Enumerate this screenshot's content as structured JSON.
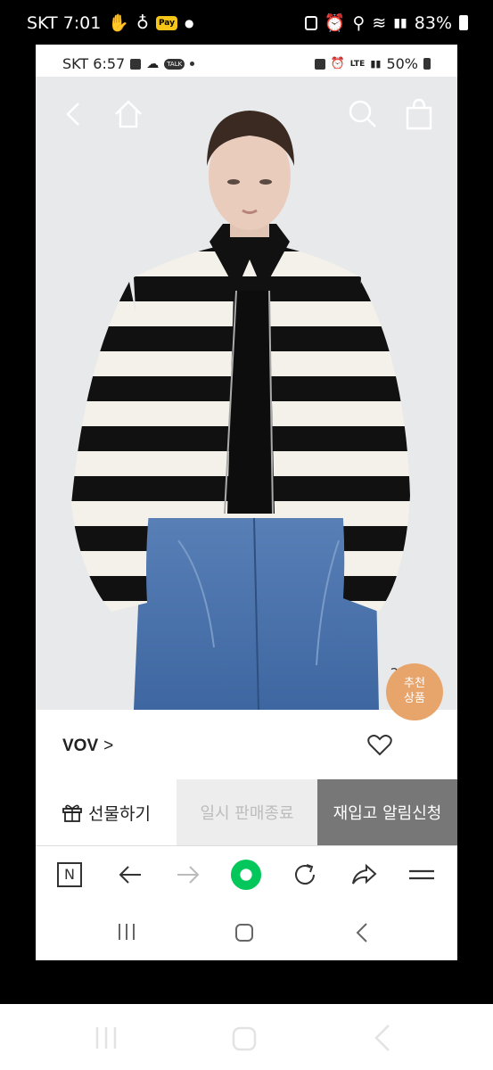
{
  "outer_status": {
    "carrier_time": "SKT 7:01",
    "pay_badge": "Pay",
    "battery": "83%"
  },
  "inner_status": {
    "carrier_time": "SKT 6:57",
    "talk_badge": "TALK",
    "network": "LTE",
    "battery": "50%"
  },
  "product": {
    "image_counter": "2 / 12",
    "brand": "VOV",
    "brand_chevron": ">"
  },
  "recommend_badge": {
    "line1": "추천",
    "line2": "상품"
  },
  "actions": {
    "gift": "선물하기",
    "soldout": "일시 판매종료",
    "restock": "재입고 알림신청"
  },
  "browser_toolbar": {
    "n_label": "N"
  },
  "colors": {
    "recommend": "#e7a56b",
    "naver_green": "#03c75a",
    "restock_bg": "#777777"
  }
}
